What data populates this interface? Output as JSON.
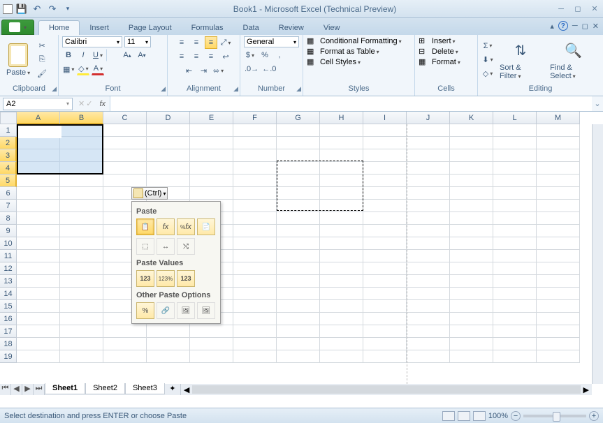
{
  "title": "Book1  -  Microsoft Excel (Technical Preview)",
  "tabs": [
    "Home",
    "Insert",
    "Page Layout",
    "Formulas",
    "Data",
    "Review",
    "View"
  ],
  "active_tab": "Home",
  "groups": {
    "clipboard": {
      "paste": "Paste",
      "label": "Clipboard"
    },
    "font": {
      "name": "Calibri",
      "size": "11",
      "label": "Font"
    },
    "alignment": {
      "label": "Alignment"
    },
    "number": {
      "format": "General",
      "label": "Number"
    },
    "styles": {
      "cf": "Conditional Formatting",
      "ft": "Format as Table",
      "cs": "Cell Styles",
      "label": "Styles"
    },
    "cells": {
      "ins": "Insert",
      "del": "Delete",
      "fmt": "Format",
      "label": "Cells"
    },
    "editing": {
      "sf": "Sort & Filter",
      "fs": "Find & Select",
      "label": "Editing"
    }
  },
  "namebox": "A2",
  "cols": [
    "A",
    "B",
    "C",
    "D",
    "E",
    "F",
    "G",
    "H",
    "I",
    "J",
    "K",
    "L",
    "M"
  ],
  "rows": [
    "1",
    "2",
    "3",
    "4",
    "5",
    "6",
    "7",
    "8",
    "9",
    "10",
    "11",
    "12",
    "13",
    "14",
    "15",
    "16",
    "17",
    "18",
    "19"
  ],
  "sel_cols": [
    "A",
    "B"
  ],
  "sel_rows": [
    "2",
    "3",
    "4",
    "5"
  ],
  "sheets": [
    "Sheet1",
    "Sheet2",
    "Sheet3"
  ],
  "active_sheet": "Sheet1",
  "status": "Select destination and press ENTER or choose Paste",
  "zoom": "100%",
  "paste_popup": {
    "button": "(Ctrl)",
    "s1": "Paste",
    "s2": "Paste Values",
    "s3": "Other Paste Options",
    "row1": [
      "paste",
      "formulas",
      "formulas-number-fmt",
      "keep-source-fmt"
    ],
    "row2": [
      "no-borders",
      "keep-col-widths",
      "transpose"
    ],
    "row3": [
      "values",
      "values-number-fmt",
      "values-source-fmt"
    ],
    "row4": [
      "formatting",
      "paste-link",
      "picture",
      "linked-picture"
    ]
  }
}
